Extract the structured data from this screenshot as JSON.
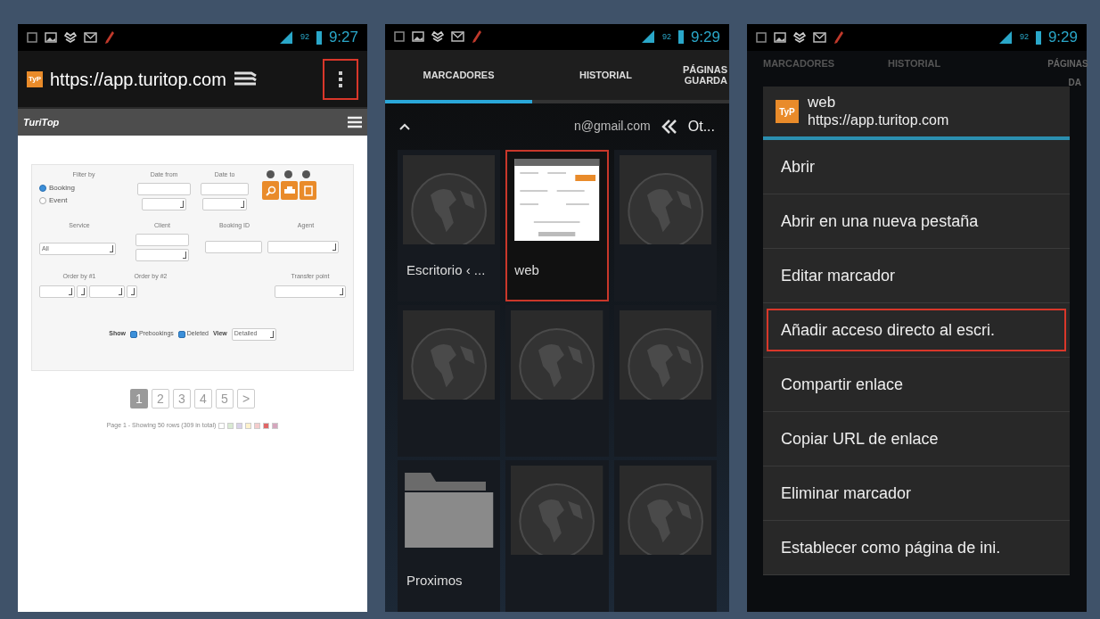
{
  "browser_screen": {
    "status_bar": {
      "battery": "92",
      "time": "9:27"
    },
    "address_bar": {
      "favicon_text": "TyP",
      "url": "https://app.turitop.com",
      "menu_button": {
        "highlighted": true
      }
    },
    "site_header": {
      "logo_text": "TuriTop"
    },
    "filter_form": {
      "filter_label": "Filter by",
      "radios": [
        {
          "label": "Booking",
          "selected": true
        },
        {
          "label": "Event",
          "selected": false
        }
      ],
      "date_from_label": "Date from",
      "date_to_label": "Date to",
      "service_label": "Service",
      "service_value": "All",
      "client_label": "Client",
      "booking_id_label": "Booking ID",
      "agent_label": "Agent",
      "order_by_1_label": "Order by #1",
      "order_by_2_label": "Order by #2",
      "transfer_label": "Transfer point",
      "show_label": "Show",
      "checkboxes": [
        {
          "label": "Prebookings",
          "checked": true
        },
        {
          "label": "Deleted",
          "checked": true
        }
      ],
      "view_label": "View",
      "view_value": "Detailed"
    },
    "pagination": [
      {
        "label": "1",
        "selected": true
      },
      {
        "label": "2",
        "selected": false
      },
      {
        "label": "3",
        "selected": false
      },
      {
        "label": "4",
        "selected": false
      },
      {
        "label": "5",
        "selected": false
      },
      {
        "label": ">",
        "selected": false
      }
    ],
    "summary": "Page 1 - Showing 50 rows (309 in total)",
    "legend": [
      {
        "color": "#ffffff"
      },
      {
        "color": "#d9ead3"
      },
      {
        "color": "#d9d2e9"
      },
      {
        "color": "#fff2cc"
      },
      {
        "color": "#f4cccc"
      },
      {
        "color": "#e06666"
      },
      {
        "color": "#d5a6bd"
      }
    ]
  },
  "bookmarks_screen": {
    "status_bar": {
      "battery": "92",
      "time": "9:29"
    },
    "tabs": [
      {
        "label": "MARCADORES",
        "selected": true
      },
      {
        "label": "HISTORIAL",
        "selected": false
      },
      {
        "label": "PÁGINAS GUARDA",
        "selected": false
      }
    ],
    "folder_bar": {
      "account": "n@gmail.com",
      "crumb": "Ot..."
    },
    "tiles": [
      {
        "kind": "globe",
        "label": "Escritorio ‹ ...",
        "highlighted": false
      },
      {
        "kind": "page",
        "label": "web",
        "highlighted": true
      },
      {
        "kind": "globe",
        "highlighted": false
      },
      {
        "kind": "globe",
        "highlighted": false
      },
      {
        "kind": "globe",
        "highlighted": false
      },
      {
        "kind": "globe",
        "highlighted": false
      },
      {
        "kind": "folder",
        "label": "Proximos",
        "highlighted": false
      },
      {
        "kind": "globe",
        "highlighted": false
      },
      {
        "kind": "globe",
        "highlighted": false
      }
    ]
  },
  "menu_screen": {
    "status_bar": {
      "battery": "92",
      "time": "9:29"
    },
    "tabs": [
      {
        "label": "MARCADORES"
      },
      {
        "label": "HISTORIAL"
      },
      {
        "label": "PÁGINAS"
      }
    ],
    "tab_fragment": "DA",
    "dialog": {
      "icon_text": "TyP",
      "title": "web",
      "url": "https://app.turitop.com",
      "items": [
        {
          "label": "Abrir",
          "highlighted": false
        },
        {
          "label": "Abrir en una nueva pestaña",
          "highlighted": false
        },
        {
          "label": "Editar marcador",
          "highlighted": false
        },
        {
          "label": "Añadir acceso directo al escri.",
          "highlighted": true
        },
        {
          "label": "Compartir enlace",
          "highlighted": false
        },
        {
          "label": "Copiar URL de enlace",
          "highlighted": false
        },
        {
          "label": "Eliminar marcador",
          "highlighted": false
        },
        {
          "label": "Establecer como página de ini.",
          "highlighted": false
        }
      ]
    }
  }
}
